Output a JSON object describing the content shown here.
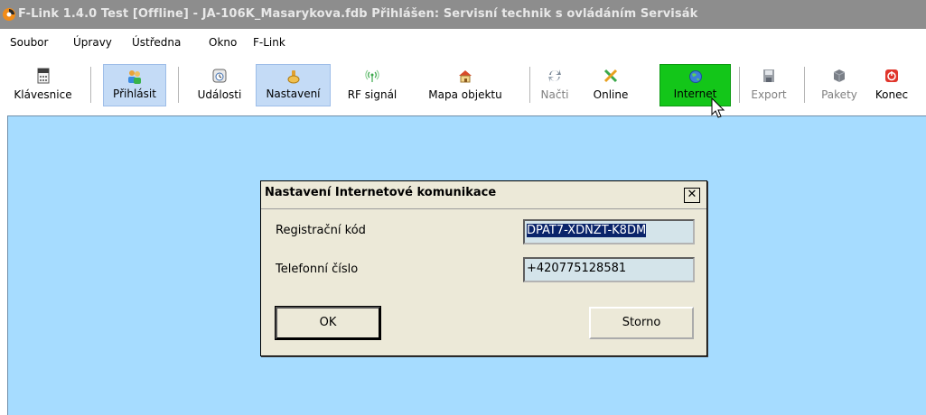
{
  "window": {
    "title": "F-Link 1.4.0 Test [Offline] - JA-106K_Masarykova.fdb Přihlášen: Servisní technik s ovládáním Servisák"
  },
  "menu": [
    {
      "label": "Soubor"
    },
    {
      "label": "Úpravy"
    },
    {
      "label": "Ústředna"
    },
    {
      "label": "Okno"
    },
    {
      "label": "F-Link"
    }
  ],
  "toolbar": {
    "items": [
      {
        "label": "Klávesnice",
        "icon": "keyboard-icon",
        "state": "normal"
      },
      {
        "label": "Přihlásit",
        "icon": "users-icon",
        "state": "active"
      },
      {
        "label": "Události",
        "icon": "events-icon",
        "state": "normal"
      },
      {
        "label": "Nastavení",
        "icon": "settings-icon",
        "state": "active"
      },
      {
        "label": "RF signál",
        "icon": "rf-signal-icon",
        "state": "normal"
      },
      {
        "label": "Mapa objektu",
        "icon": "house-icon",
        "state": "normal"
      },
      {
        "label": "Načti",
        "icon": "reload-icon",
        "state": "disabled"
      },
      {
        "label": "Online",
        "icon": "online-icon",
        "state": "normal"
      },
      {
        "label": "Internet",
        "icon": "globe-icon",
        "state": "highlighted"
      },
      {
        "label": "Export",
        "icon": "save-icon",
        "state": "disabled"
      },
      {
        "label": "Pakety",
        "icon": "packets-icon",
        "state": "disabled"
      },
      {
        "label": "Konec",
        "icon": "power-icon",
        "state": "normal"
      }
    ]
  },
  "dialog": {
    "title": "Nastavení Internetové komunikace",
    "close_glyph": "✕",
    "fields": [
      {
        "label": "Registrační kód",
        "value": "DPAT7-XDNZT-K8DM"
      },
      {
        "label": "Telefonní číslo",
        "value": "+420775128581"
      }
    ],
    "ok_label": "OK",
    "cancel_label": "Storno"
  },
  "colors": {
    "title_bar": "#8d8d8d",
    "workspace": "#a6dcff",
    "active_button": "#c4dbf6",
    "internet_button": "#13c619",
    "dialog_bg": "#ece9d8"
  }
}
